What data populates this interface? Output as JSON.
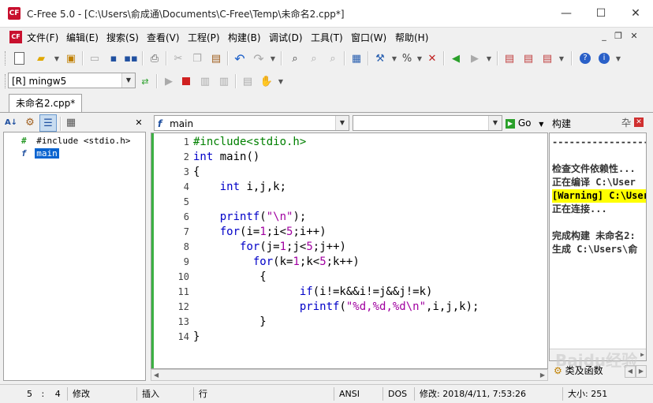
{
  "window": {
    "title": "C-Free 5.0 - [C:\\Users\\俞成通\\Documents\\C-Free\\Temp\\未命名2.cpp*]",
    "app_icon_text": "CF",
    "controls": [
      "minimize-icon",
      "maximize-icon",
      "close-icon"
    ]
  },
  "menu": {
    "items": [
      "文件(F)",
      "编辑(E)",
      "搜索(S)",
      "查看(V)",
      "工程(P)",
      "构建(B)",
      "调试(D)",
      "工具(T)",
      "窗口(W)",
      "帮助(H)"
    ]
  },
  "toolbar": {
    "compiler_select": "[R] mingw5"
  },
  "tabs": [
    {
      "label": "未命名2.cpp*",
      "active": true
    }
  ],
  "symbol_tree": {
    "items": [
      {
        "label": "#include <stdio.h>",
        "icon": "include-icon"
      },
      {
        "label": "main",
        "icon": "function-icon",
        "selected": true
      }
    ]
  },
  "editor": {
    "function_select": "main",
    "member_select": "",
    "go_label": "Go",
    "lines": [
      {
        "n": "1",
        "text": "#include<stdio.h>"
      },
      {
        "n": "2",
        "text": "int main()"
      },
      {
        "n": "3",
        "text": "{"
      },
      {
        "n": "4",
        "text": "    int i,j,k;"
      },
      {
        "n": "5",
        "text": ""
      },
      {
        "n": "6",
        "text": "    printf(\"\\n\");"
      },
      {
        "n": "7",
        "text": "    for(i=1;i<5;i++)"
      },
      {
        "n": "8",
        "text": "       for(j=1;j<5;j++)"
      },
      {
        "n": "9",
        "text": "         for(k=1;k<5;k++)"
      },
      {
        "n": "10",
        "text": "          {"
      },
      {
        "n": "11",
        "text": "                if(i!=k&&i!=j&&j!=k)"
      },
      {
        "n": "12",
        "text": "                printf(\"%d,%d,%d\\n\",i,j,k);"
      },
      {
        "n": "13",
        "text": "          }"
      },
      {
        "n": "14",
        "text": "}"
      }
    ]
  },
  "build_panel": {
    "title": "构建",
    "lines": [
      {
        "text": "--------------------",
        "style": "normal"
      },
      {
        "text": "",
        "style": "normal"
      },
      {
        "text": "检查文件依赖性...",
        "style": "normal"
      },
      {
        "text": "正在编译 C:\\User",
        "style": "normal"
      },
      {
        "text": "[Warning] C:\\User",
        "style": "warning"
      },
      {
        "text": "正在连接...",
        "style": "normal"
      },
      {
        "text": "",
        "style": "normal"
      },
      {
        "text": "完成构建 未命名2:",
        "style": "normal"
      },
      {
        "text": "生成 C:\\Users\\俞",
        "style": "normal"
      }
    ],
    "bottom_tab": "类及函数",
    "watermark": "Baidu经验"
  },
  "status": {
    "line": "5",
    "col": "4",
    "modified": "修改",
    "insert": "插入",
    "row_mode": "行",
    "encoding": "ANSI",
    "eol": "DOS",
    "modified_time": "修改: 2018/4/11, 7:53:26",
    "size": "大小: 251"
  },
  "colors": {
    "keyword": "#0000c8",
    "string": "#a000a0",
    "preprocessor": "#008000",
    "warning_bg": "#ffff00",
    "gutter_marker": "#3cb043"
  }
}
